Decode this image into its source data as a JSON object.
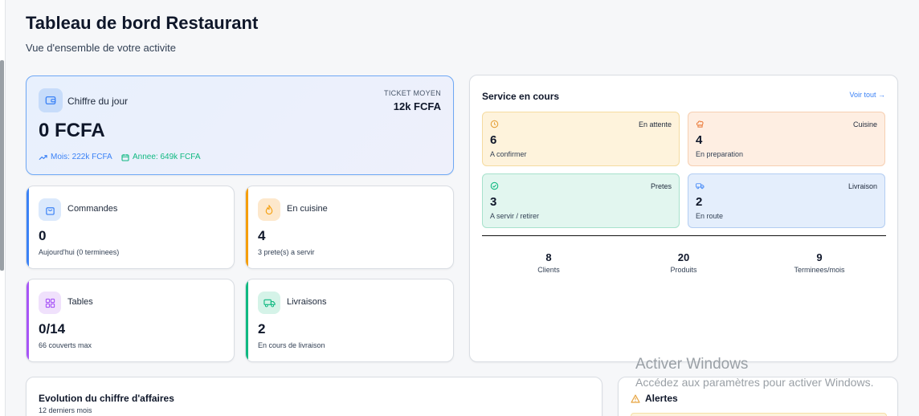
{
  "header": {
    "title": "Tableau de bord Restaurant",
    "subtitle": "Vue d'ensemble de votre activite"
  },
  "revenue": {
    "label": "Chiffre du jour",
    "value": "0 FCFA",
    "ticket_label": "TICKET MOYEN",
    "ticket_value": "12k FCFA",
    "month": "Mois: 222k FCFA",
    "year": "Annee: 649k FCFA",
    "icon": "wallet-icon"
  },
  "stats": [
    {
      "label": "Commandes",
      "value": "0",
      "sub": "Aujourd'hui (0 terminees)",
      "icon": "shopping-bag-icon",
      "accent": "#3b82f6"
    },
    {
      "label": "En cuisine",
      "value": "4",
      "sub": "3 prete(s) a servir",
      "icon": "flame-icon",
      "accent": "#f59e0b"
    },
    {
      "label": "Tables",
      "value": "0/14",
      "sub": "66 couverts max",
      "icon": "grid-icon",
      "accent": "#a855f7"
    },
    {
      "label": "Livraisons",
      "value": "2",
      "sub": "En cours de livraison",
      "icon": "truck-icon",
      "accent": "#10b981"
    }
  ],
  "service": {
    "title": "Service en cours",
    "view_all": "Voir tout →",
    "items": [
      {
        "tag": "En attente",
        "value": "6",
        "desc": "A confirmer",
        "icon": "clock-icon"
      },
      {
        "tag": "Cuisine",
        "value": "4",
        "desc": "En preparation",
        "icon": "chef-hat-icon"
      },
      {
        "tag": "Pretes",
        "value": "3",
        "desc": "A servir / retirer",
        "icon": "check-circle-icon"
      },
      {
        "tag": "Livraison",
        "value": "2",
        "desc": "En route",
        "icon": "truck-icon"
      }
    ],
    "kpis": [
      {
        "value": "8",
        "label": "Clients"
      },
      {
        "value": "20",
        "label": "Produits"
      },
      {
        "value": "9",
        "label": "Terminees/mois"
      }
    ]
  },
  "chart_section": {
    "title": "Evolution du chiffre d'affaires",
    "subtitle": "12 derniers mois"
  },
  "alerts": {
    "title": "Alertes",
    "icon": "warning-icon"
  },
  "watermark": {
    "line1": "Activer Windows",
    "line2": "Accédez aux paramètres pour activer Windows."
  },
  "colors": {
    "accent_blue": "#3b82f6",
    "accent_orange": "#f59e0b",
    "accent_purple": "#a855f7",
    "accent_green": "#10b981"
  }
}
